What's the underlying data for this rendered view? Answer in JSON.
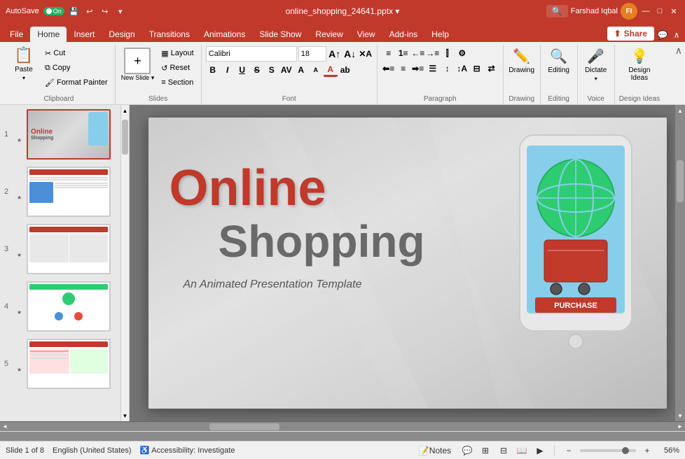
{
  "titlebar": {
    "autosave_label": "AutoSave",
    "toggle_state": "On",
    "title": "online_shopping_24641.pptx",
    "user": "Farshad Iqbal",
    "min_btn": "—",
    "max_btn": "□",
    "close_btn": "✕",
    "search_placeholder": "🔍"
  },
  "ribbon_tabs": {
    "file": "File",
    "home": "Home",
    "insert": "Insert",
    "design": "Design",
    "transitions": "Transitions",
    "animations": "Animations",
    "slideshow": "Slide Show",
    "review": "Review",
    "view": "View",
    "addins": "Add-ins",
    "help": "Help",
    "share": "Share"
  },
  "ribbon": {
    "clipboard": {
      "label": "Clipboard",
      "paste": "Paste",
      "copy": "Copy",
      "cut": "Cut",
      "format": "Format Painter"
    },
    "slides": {
      "label": "Slides",
      "new_slide": "New Slide",
      "layout": "Layout",
      "reset": "Reset",
      "section": "Section"
    },
    "font": {
      "label": "Font",
      "family_placeholder": "Calibri",
      "size_placeholder": "18",
      "bold": "B",
      "italic": "I",
      "underline": "U",
      "strikethrough": "S",
      "shadow": "s"
    },
    "paragraph": {
      "label": "Paragraph"
    },
    "drawing": {
      "label": "Drawing",
      "icon": "✏️"
    },
    "editing": {
      "label": "Editing",
      "icon": "🔍"
    },
    "dictate": {
      "label": "Dictate",
      "icon": "🎤"
    },
    "designer": {
      "label": "Design Ideas",
      "icon": "💡"
    }
  },
  "slides": [
    {
      "num": "1",
      "star": "★",
      "active": true
    },
    {
      "num": "2",
      "star": "★",
      "active": false
    },
    {
      "num": "3",
      "star": "★",
      "active": false
    },
    {
      "num": "4",
      "star": "★",
      "active": false
    },
    {
      "num": "5",
      "star": "★",
      "active": false
    }
  ],
  "slide1": {
    "title_line1": "Online",
    "title_line2": "Shopping",
    "subtitle": "An Animated Presentation Template",
    "purchase_btn": "PURCHASE"
  },
  "statusbar": {
    "slide_info": "Slide 1 of 8",
    "language": "English (United States)",
    "accessibility": "Accessibility: Investigate",
    "notes": "Notes",
    "zoom": "56%"
  }
}
